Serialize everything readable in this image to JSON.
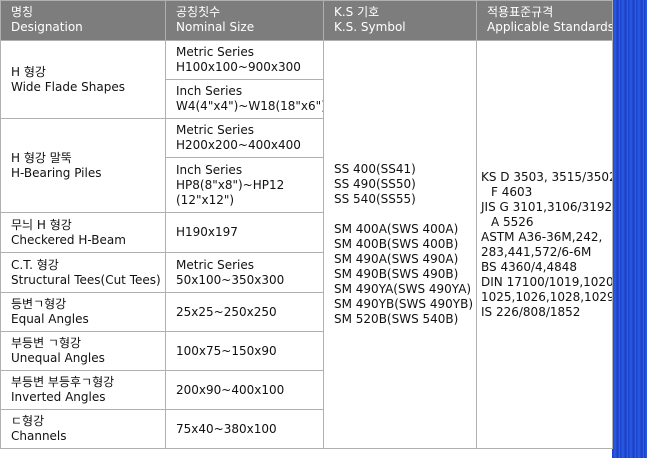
{
  "headers": [
    {
      "ko": "명칭",
      "en": "Designation"
    },
    {
      "ko": "공칭칫수",
      "en": "Nominal Size"
    },
    {
      "ko": "K.S 기호",
      "en": "K.S. Symbol"
    },
    {
      "ko": "적용표준규격",
      "en": "Applicable Standards"
    }
  ],
  "rows": [
    {
      "ko": "H 형강",
      "en": "Wide Flade Shapes",
      "sizes": [
        {
          "l1": "Metric Series",
          "l2": "H100x100~900x300"
        },
        {
          "l1": "Inch Series",
          "l2": "W4(4\"x4\")~W18(18\"x6\")"
        }
      ]
    },
    {
      "ko": "H 형강 말뚝",
      "en": "H-Bearing Piles",
      "sizes": [
        {
          "l1": "Metric Series",
          "l2": "H200x200~400x400"
        },
        {
          "l1": "Inch Series",
          "l2": "HP8(8\"x8\")~HP12",
          "l3": "(12\"x12\")"
        }
      ]
    },
    {
      "ko": "무늬 H 형강",
      "en": "Checkered H-Beam",
      "size": "H190x197"
    },
    {
      "ko": "C.T. 형강",
      "en": "Structural Tees(Cut Tees)",
      "size_l1": "Metric Series",
      "size_l2": "50x100~350x300"
    },
    {
      "ko": "등변ㄱ형강",
      "en": "Equal Angles",
      "size": "25x25~250x250"
    },
    {
      "ko": "부등변 ㄱ형강",
      "en": "Unequal Angles",
      "size": "100x75~150x90"
    },
    {
      "ko": "부등변 부등후ㄱ형강",
      "en": "Inverted Angles",
      "size": "200x90~400x100"
    },
    {
      "ko": "ㄷ형강",
      "en": "Channels",
      "size": "75x40~380x100"
    }
  ],
  "symbols": [
    "SS 400(SS41)",
    "SS 490(SS50)",
    "SS 540(SS55)",
    "",
    "SM 400A(SWS 400A)",
    "SM 400B(SWS 400B)",
    "SM 490A(SWS 490A)",
    "SM 490B(SWS 490B)",
    "SM 490YA(SWS 490YA)",
    "SM 490YB(SWS 490YB)",
    "SM 520B(SWS 540B)"
  ],
  "standards": [
    {
      "text": "KS D 3503, 3515/3502",
      "indent": false
    },
    {
      "text": "F 4603",
      "indent": true
    },
    {
      "text": "JIS G 3101,3106/3192",
      "indent": false
    },
    {
      "text": "A 5526",
      "indent": true
    },
    {
      "text": "ASTM A36-36M,242,",
      "indent": false
    },
    {
      "text": "283,441,572/6-6M",
      "indent": false
    },
    {
      "text": "BS 4360/4,4848",
      "indent": false
    },
    {
      "text": "DIN 17100/1019,1020,",
      "indent": false
    },
    {
      "text": "1025,1026,1028,1029",
      "indent": false
    },
    {
      "text": "IS 226/808/1852",
      "indent": false
    }
  ]
}
